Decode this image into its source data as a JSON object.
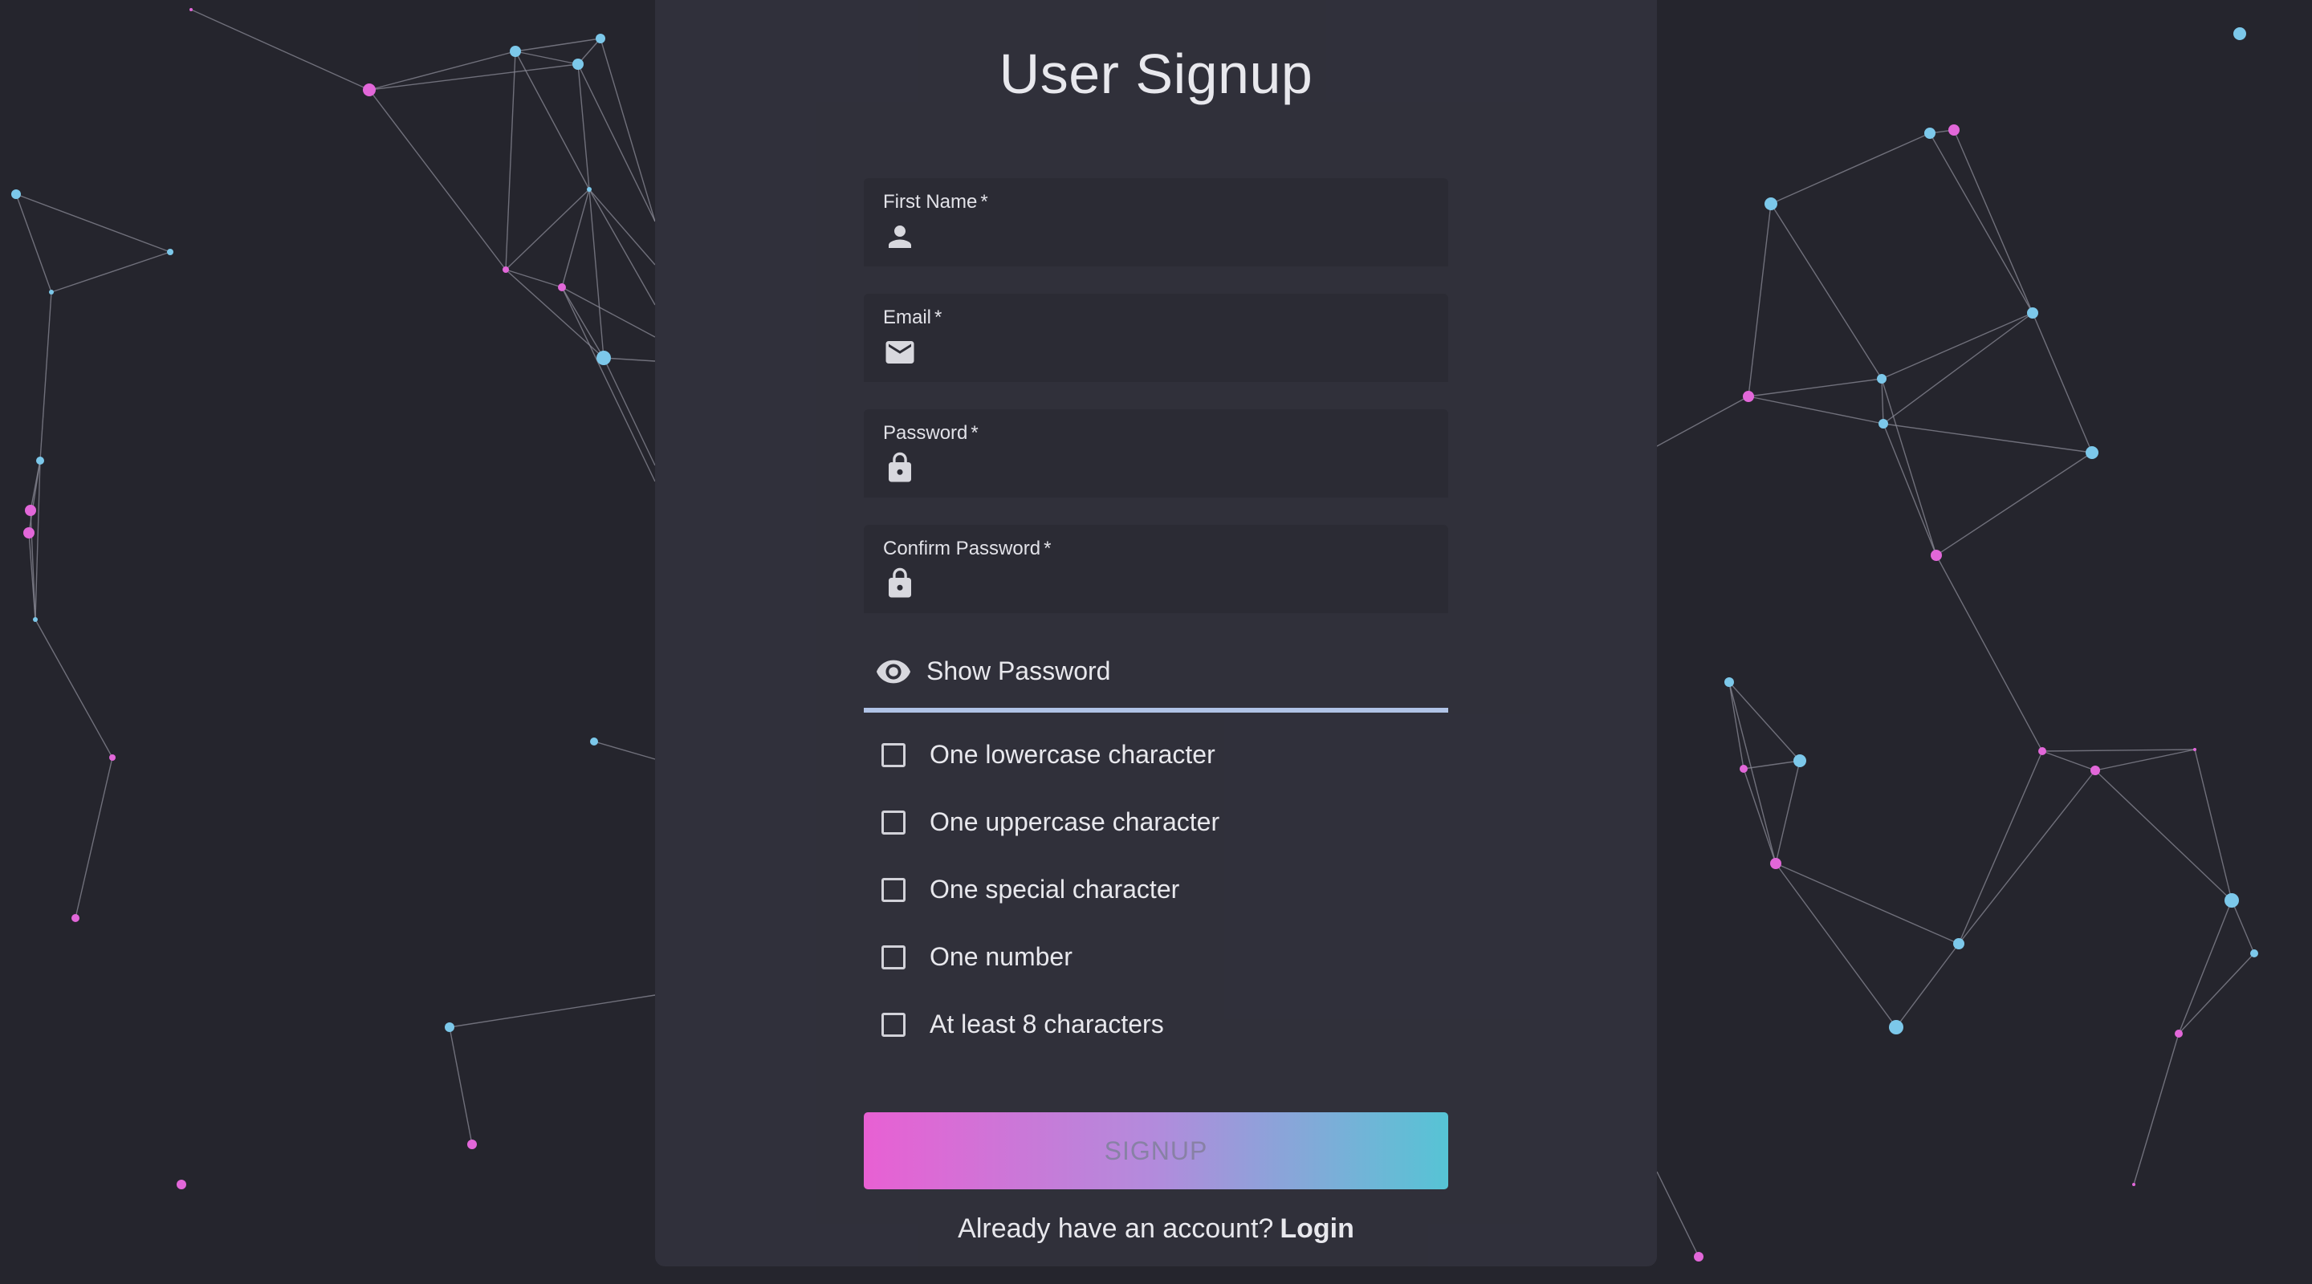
{
  "page": {
    "title": "User Signup"
  },
  "form": {
    "fields": [
      {
        "label": "First Name",
        "required_mark": "*",
        "icon": "person-icon",
        "value": ""
      },
      {
        "label": "Email",
        "required_mark": "*",
        "icon": "email-icon",
        "value": ""
      },
      {
        "label": "Password",
        "required_mark": "*",
        "icon": "lock-icon",
        "value": ""
      },
      {
        "label": "Confirm Password",
        "required_mark": "*",
        "icon": "lock-icon",
        "value": ""
      }
    ],
    "show_password": {
      "label": "Show Password",
      "icon": "eye-icon"
    },
    "requirements": [
      {
        "label": "One lowercase character",
        "checked": false
      },
      {
        "label": "One uppercase character",
        "checked": false
      },
      {
        "label": "One special character",
        "checked": false
      },
      {
        "label": "One number",
        "checked": false
      },
      {
        "label": "At least 8 characters",
        "checked": false
      }
    ],
    "submit_label": "SIGNUP"
  },
  "footer": {
    "prompt": "Already have an account?",
    "login_label": "Login"
  },
  "colors": {
    "background": "#25252d",
    "card": "#31313b",
    "field": "#2c2c35",
    "underline": "#b3c7ea",
    "gradient_start": "#ec62d7",
    "gradient_end": "#58c8d9",
    "node_pink": "#e267d9",
    "node_blue": "#7cc8ea"
  }
}
